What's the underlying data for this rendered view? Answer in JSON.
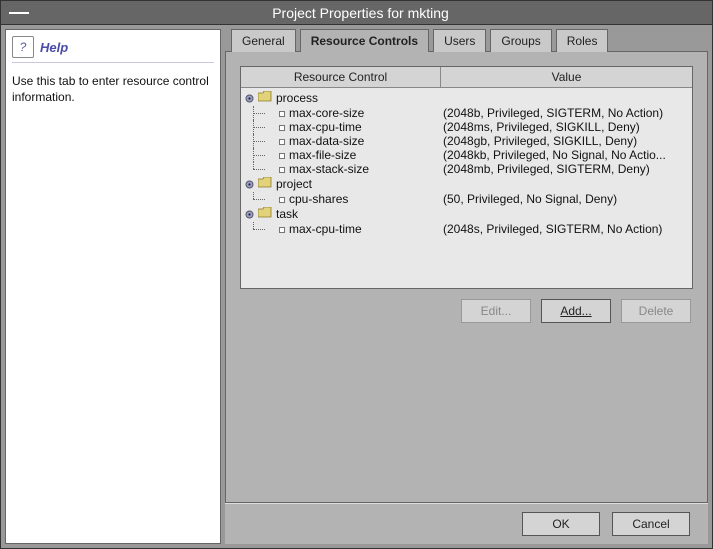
{
  "window": {
    "title": "Project Properties for mkting"
  },
  "help": {
    "title": "Help",
    "body": "Use this tab to enter resource control information."
  },
  "tabs": {
    "general": "General",
    "resource_controls": "Resource Controls",
    "users": "Users",
    "groups": "Groups",
    "roles": "Roles"
  },
  "table": {
    "headers": {
      "name": "Resource Control",
      "value": "Value"
    },
    "groups": [
      {
        "label": "process",
        "children": [
          {
            "name": "max-core-size",
            "value": "(2048b, Privileged, SIGTERM, No Action)"
          },
          {
            "name": "max-cpu-time",
            "value": "(2048ms, Privileged, SIGKILL, Deny)"
          },
          {
            "name": "max-data-size",
            "value": "(2048gb, Privileged, SIGKILL, Deny)"
          },
          {
            "name": "max-file-size",
            "value": "(2048kb, Privileged, No Signal, No Actio..."
          },
          {
            "name": "max-stack-size",
            "value": "(2048mb, Privileged, SIGTERM, Deny)"
          }
        ]
      },
      {
        "label": "project",
        "children": [
          {
            "name": "cpu-shares",
            "value": "(50, Privileged, No Signal, Deny)"
          }
        ]
      },
      {
        "label": "task",
        "children": [
          {
            "name": "max-cpu-time",
            "value": "(2048s, Privileged, SIGTERM, No Action)"
          }
        ]
      }
    ]
  },
  "buttons": {
    "edit": "Edit...",
    "add": "Add...",
    "delete": "Delete",
    "ok": "OK",
    "cancel": "Cancel"
  }
}
